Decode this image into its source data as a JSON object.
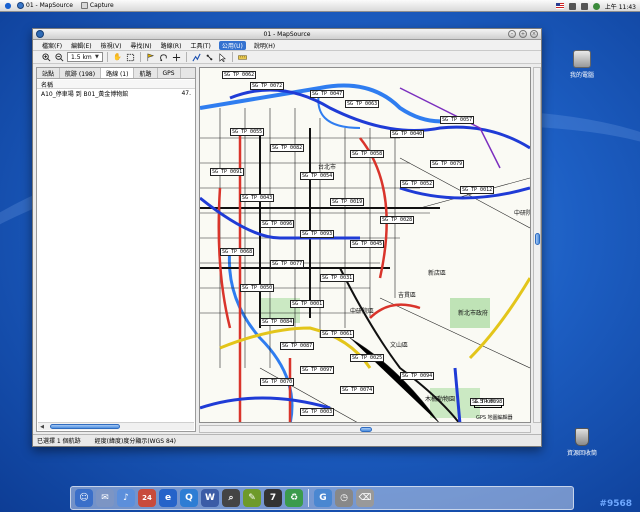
{
  "colors": {
    "desktop": "#1d5fc4",
    "menu_active": "#3472d0",
    "road_highway": "#1f3bd6",
    "road_major": "#d9342b",
    "road_trunk": "#e3c51a",
    "river": "#2f7df0",
    "green_area": "#8fd08f"
  },
  "menubar": {
    "apple_icon": "apple-icon",
    "apps": [
      {
        "label": "01 - MapSource"
      },
      {
        "label": "Capture"
      }
    ],
    "clock": "上午 11:43"
  },
  "window": {
    "title": "01 - MapSource",
    "menu": [
      "檔案(F)",
      "編輯(E)",
      "檢視(V)",
      "尋找(N)",
      "路線(R)",
      "工具(T)",
      "公用(U)",
      "說明(H)"
    ],
    "active_menu_index": 6,
    "toolbar": {
      "zoom_value": "1.5 km",
      "buttons": [
        "zoom-in-icon",
        "zoom-out-icon",
        "hand-icon",
        "select-icon",
        "pan-icon",
        "route-icon",
        "distance-icon",
        "pointer-icon",
        "measure-icon"
      ]
    },
    "tabs": [
      "站點",
      "航跡 (198)",
      "路線 (1)",
      "航路",
      "GPS"
    ],
    "selected_tab": 2,
    "list": {
      "header": "名稱",
      "rows": [
        {
          "name": "A10_停車場 到 B01_黃金博物館",
          "value": "47."
        }
      ]
    },
    "status": {
      "selection": "已選擇 1 個航跡",
      "coords": "經度(緯度)度分顯示(WGS 84)"
    }
  },
  "map": {
    "places": [
      {
        "text": "台北市"
      },
      {
        "text": "中研院"
      },
      {
        "text": "吉貫區"
      },
      {
        "text": "新店區"
      },
      {
        "text": "新北市政府"
      },
      {
        "text": "文山區"
      },
      {
        "text": "木柵動物園"
      },
      {
        "text": "中研院區"
      }
    ],
    "waypoints": [
      "SG TP 0062",
      "SG TP 0072",
      "SG TP 0047",
      "SG TP 0063",
      "SG TP 0057",
      "SG TP 0055",
      "SG TP 0040",
      "SG TP 0082",
      "SG TP 0058",
      "SG TP 0079",
      "SG TP 0091",
      "SG TP 0054",
      "SG TP 0052",
      "SG TP 0012",
      "SG TP 0043",
      "SG TP 0019",
      "SG TP 0028",
      "SG TP 0096",
      "SG TP 0093",
      "SG TP 0045",
      "SG TP 0068",
      "SG TP 0077",
      "SG TP 0031",
      "SG TP 0050",
      "SG TP 0001",
      "SG TP 0084",
      "SG TP 0061",
      "SG TP 0087",
      "SG TP 0025",
      "SG TP 0097",
      "SG TP 0070",
      "SG TP 0074",
      "SG TP 0098",
      "SG TP 0003",
      "SG TP 0094"
    ],
    "scale_label": "1.5 km",
    "footer_note": "GPS 地圖編輯器"
  },
  "desktop_icons": [
    {
      "label": "我的電腦",
      "icon": "computer-icon"
    },
    {
      "label": "資源回收筒",
      "icon": "trash-icon"
    }
  ],
  "dock": {
    "items": [
      {
        "icon": "finder-icon",
        "color": "#3a6fc9"
      },
      {
        "icon": "mail-icon",
        "color": "#7c95c4"
      },
      {
        "icon": "itunes-icon",
        "color": "#5c8fdb"
      },
      {
        "icon": "calendar-icon",
        "color": "#c84b3c"
      },
      {
        "icon": "ie-icon",
        "color": "#2563c9"
      },
      {
        "icon": "quicktime-icon",
        "color": "#2d7dd4"
      },
      {
        "icon": "word-icon",
        "color": "#3b5ca6"
      },
      {
        "icon": "sherlock-icon",
        "color": "#444"
      },
      {
        "icon": "preview-icon",
        "color": "#6e9a2a"
      },
      {
        "icon": "terminal-icon",
        "color": "#333"
      },
      {
        "icon": "recycle-icon",
        "color": "#3b9b4c"
      },
      {
        "icon": "garmin-icon",
        "color": "#4a87d1"
      },
      {
        "icon": "clock-icon",
        "color": "#888"
      },
      {
        "icon": "trash-dock-icon",
        "color": "#999"
      }
    ],
    "calendar_day": "24"
  },
  "watermark": "#9568"
}
